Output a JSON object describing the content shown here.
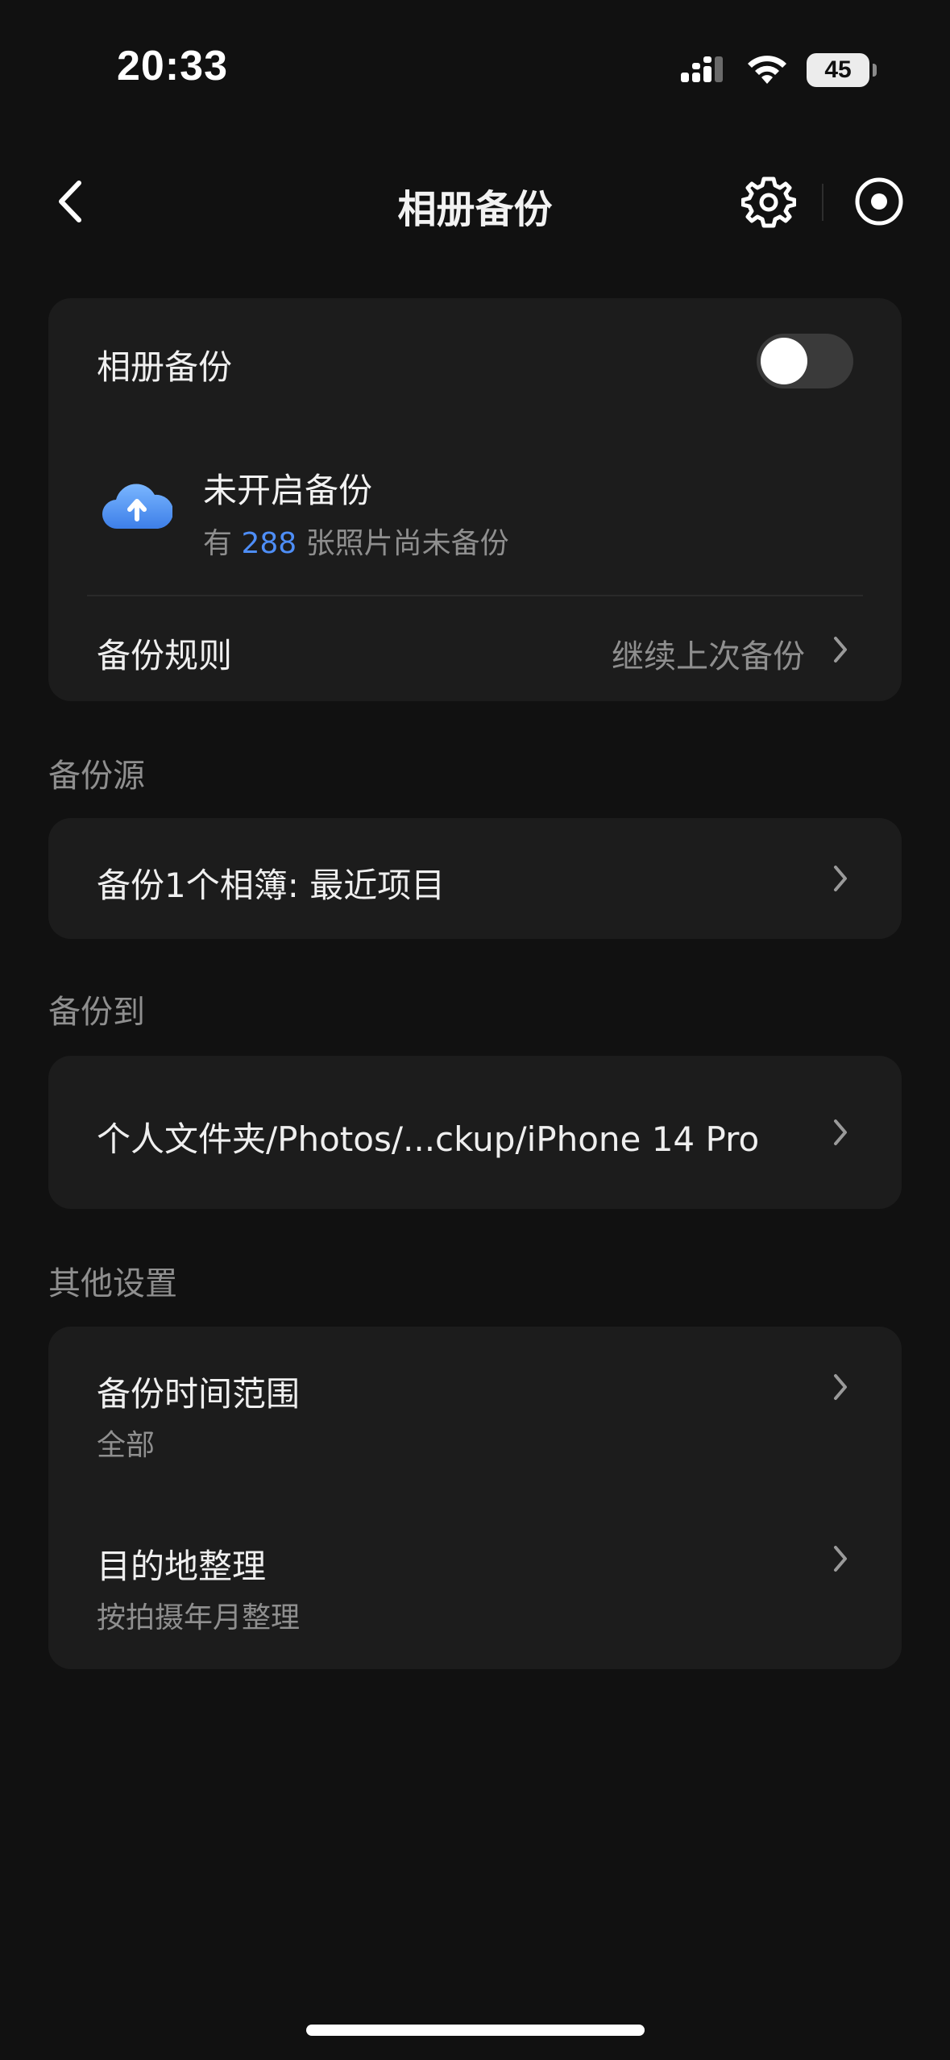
{
  "status_bar": {
    "time": "20:33",
    "battery": "45",
    "icons": [
      "signal-icon",
      "wifi-icon",
      "battery-icon"
    ]
  },
  "nav": {
    "title": "相册备份",
    "icons": [
      "back-chevron-icon",
      "gear-icon",
      "record-icon"
    ]
  },
  "backup_card": {
    "toggle_label": "相册备份",
    "toggle_on": false,
    "status_title": "未开启备份",
    "status_prefix": "有",
    "status_count": "288",
    "status_suffix": "张照片尚未备份",
    "rule_label": "备份规则",
    "rule_value": "继续上次备份"
  },
  "source_section": {
    "label": "备份源",
    "item": "备份1个相簿: 最近项目"
  },
  "dest_section": {
    "label": "备份到",
    "item": "个人文件夹/Photos/...ckup/iPhone 14 Pro"
  },
  "other_section": {
    "label": "其他设置",
    "items": [
      {
        "title": "备份时间范围",
        "value": "全部"
      },
      {
        "title": "目的地整理",
        "value": "按拍摄年月整理"
      }
    ]
  },
  "colors": {
    "background": "#111111",
    "card": "#1c1c1c",
    "accent": "#4e8ef7",
    "secondary_text": "#8f8f8f"
  }
}
